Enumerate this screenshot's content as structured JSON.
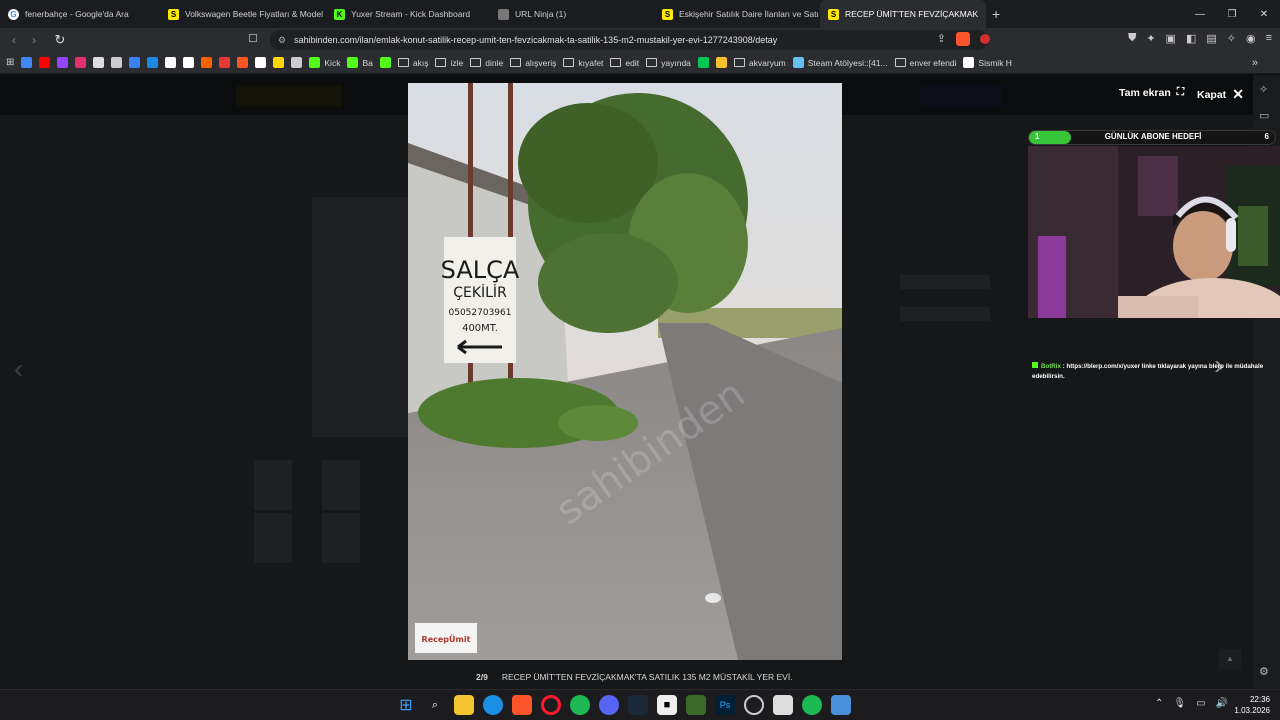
{
  "tabs": [
    {
      "title": "fenerbahçe - Google'da Ara",
      "favicon": "google-icon"
    },
    {
      "title": "Volkswagen Beetle Fiyatları & Model",
      "favicon": "sahibinden-icon"
    },
    {
      "title": "Yuxer Stream - Kick Dashboard",
      "favicon": "kick-icon"
    },
    {
      "title": "URL Ninja (1)",
      "favicon": "ninja-icon"
    },
    {
      "title": "Eskişehir Satılık Daire İlanları ve Satı",
      "favicon": "sahibinden-icon"
    },
    {
      "title": "RECEP ÜMİT'TEN FEVZİÇAKMAK",
      "favicon": "sahibinden-icon",
      "active": true
    }
  ],
  "address": {
    "url": "sahibinden.com/ilan/emlak-konut-satilik-recep-umit-ten-fevzicakmak-ta-satilik-135-m2-mustakil-yer-evi-1277243908/detay"
  },
  "bookmarks": [
    {
      "label": "",
      "icon": "google-icon",
      "color": "#4285f4"
    },
    {
      "label": "",
      "icon": "youtube-icon",
      "color": "#ff0000"
    },
    {
      "label": "",
      "icon": "twitch-icon",
      "color": "#9146ff"
    },
    {
      "label": "",
      "icon": "instagram-icon",
      "color": "#e1306c"
    },
    {
      "label": "",
      "icon": "x-icon",
      "color": "#dddddd"
    },
    {
      "label": "",
      "icon": "github-icon",
      "color": "#cccccc"
    },
    {
      "label": "",
      "icon": "cloud-icon",
      "color": "#3b82f6"
    },
    {
      "label": "",
      "icon": "play-icon",
      "color": "#1e88e5"
    },
    {
      "label": "",
      "icon": "tw-icon",
      "color": "#ffffff"
    },
    {
      "label": "",
      "icon": "dot-icon",
      "color": "#ffffff"
    },
    {
      "label": "",
      "icon": "hb-icon",
      "color": "#ff6000"
    },
    {
      "label": "",
      "icon": "circle-icon",
      "color": "#e53935"
    },
    {
      "label": "",
      "icon": "m-icon",
      "color": "#ff5722"
    },
    {
      "label": "",
      "icon": "amazon-icon",
      "color": "#ffffff"
    },
    {
      "label": "",
      "icon": "bee-icon",
      "color": "#ffd600"
    },
    {
      "label": "",
      "icon": "file-icon",
      "color": "#cccccc"
    },
    {
      "label": "Kick",
      "icon": "kick-icon",
      "color": "#53fc18"
    },
    {
      "label": "Ba",
      "icon": "kick-icon",
      "color": "#53fc18"
    },
    {
      "label": "",
      "icon": "green-icon",
      "color": "#53fc18"
    },
    {
      "label": "akış",
      "icon": "folder-icon"
    },
    {
      "label": "izle",
      "icon": "folder-icon"
    },
    {
      "label": "dinle",
      "icon": "folder-icon"
    },
    {
      "label": "alışveriş",
      "icon": "folder-icon"
    },
    {
      "label": "kıyafet",
      "icon": "folder-icon"
    },
    {
      "label": "edit",
      "icon": "folder-icon"
    },
    {
      "label": "yayında",
      "icon": "folder-icon"
    },
    {
      "label": "",
      "icon": "q-icon",
      "color": "#00c853"
    },
    {
      "label": "",
      "icon": "cards-icon",
      "color": "#fbc02d"
    },
    {
      "label": "akvaryum",
      "icon": "folder-icon"
    },
    {
      "label": "Steam Atölyesi::[41...",
      "icon": "steam-icon",
      "color": "#66c0f4"
    },
    {
      "label": "enver efendi",
      "icon": "folder-icon"
    },
    {
      "label": "Sismik H",
      "icon": "globe-icon",
      "color": "#ffffff"
    }
  ],
  "lightbox": {
    "photo_id": "#1277243908",
    "fullscreen_label": "Tam ekran",
    "close_label": "Kapat",
    "counter": "2/9",
    "caption": "RECEP ÜMİT'TEN FEVZİÇAKMAK'TA SATILIK 135 M2 MÜSTAKİL YER EVİ.",
    "sign_lines": [
      "SALÇA",
      "ÇEKİLİR",
      "05052703961",
      "400MT."
    ],
    "watermark": "sahibinden",
    "agency_logo": "RecepÜmit"
  },
  "overlay": {
    "goal_label": "GÜNLÜK ABONE HEDEFİ",
    "goal_current": "1",
    "goal_target": "6",
    "goal_progress": 0.17,
    "chat_user": "BotRix",
    "chat_message": ": https://blerp.com/x/yuxer linke tıklayarak yayına blerp ile müdahale edebilirsin."
  },
  "taskbar": {
    "time": "22:36",
    "date": "1.03.2026"
  }
}
